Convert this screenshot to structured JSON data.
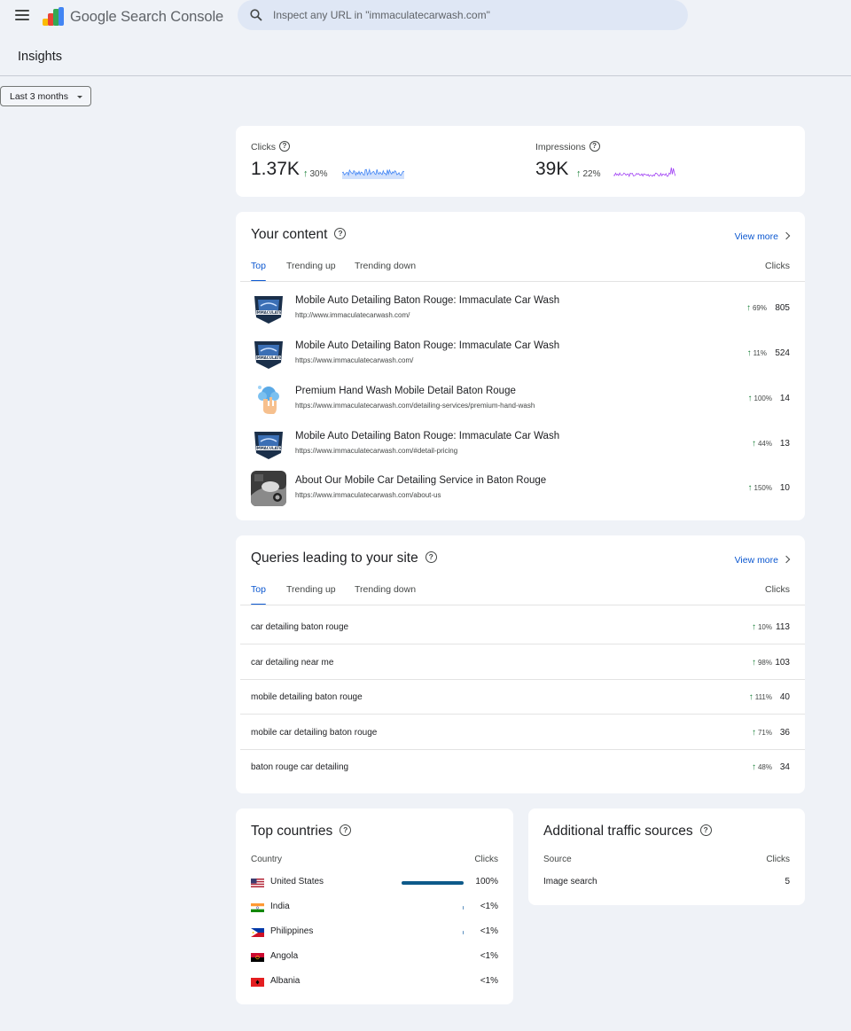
{
  "app": {
    "product_name": "Google Search Console",
    "search_placeholder": "Inspect any URL in \"immaculatecarwash.com\""
  },
  "page": {
    "title": "Insights",
    "date_filter": "Last 3 months"
  },
  "metrics": {
    "clicks": {
      "label": "Clicks",
      "value": "1.37K",
      "change": "30%",
      "spark_color": "#4285f4"
    },
    "impressions": {
      "label": "Impressions",
      "value": "39K",
      "change": "22%",
      "spark_color": "#a142f4"
    }
  },
  "content": {
    "title": "Your content",
    "view_more": "View more",
    "tabs": [
      "Top",
      "Trending up",
      "Trending down"
    ],
    "column": "Clicks",
    "rows": [
      {
        "title": "Mobile Auto Detailing Baton Rouge: Immaculate Car Wash",
        "url": "http://www.immaculatecarwash.com/",
        "change": "69%",
        "clicks": "805",
        "thumb": "logo-badge"
      },
      {
        "title": "Mobile Auto Detailing Baton Rouge: Immaculate Car Wash",
        "url": "https://www.immaculatecarwash.com/",
        "change": "11%",
        "clicks": "524",
        "thumb": "logo-badge"
      },
      {
        "title": "Premium Hand Wash Mobile Detail Baton Rouge",
        "url": "https://www.immaculatecarwash.com/detailing-services/premium-hand-wash",
        "change": "100%",
        "clicks": "14",
        "thumb": "hand-wash-icon"
      },
      {
        "title": "Mobile Auto Detailing Baton Rouge: Immaculate Car Wash",
        "url": "https://www.immaculatecarwash.com/#detail-pricing",
        "change": "44%",
        "clicks": "13",
        "thumb": "logo-badge"
      },
      {
        "title": "About Our Mobile Car Detailing Service in Baton Rouge",
        "url": "https://www.immaculatecarwash.com/about-us",
        "change": "150%",
        "clicks": "10",
        "thumb": "car-photo"
      }
    ]
  },
  "queries": {
    "title": "Queries leading to your site",
    "view_more": "View more",
    "tabs": [
      "Top",
      "Trending up",
      "Trending down"
    ],
    "column": "Clicks",
    "rows": [
      {
        "query": "car detailing baton rouge",
        "change": "10%",
        "clicks": "113"
      },
      {
        "query": "car detailing near me",
        "change": "98%",
        "clicks": "103"
      },
      {
        "query": "mobile detailing baton rouge",
        "change": "111%",
        "clicks": "40"
      },
      {
        "query": "mobile car detailing baton rouge",
        "change": "71%",
        "clicks": "36"
      },
      {
        "query": "baton rouge car detailing",
        "change": "48%",
        "clicks": "34"
      }
    ]
  },
  "countries": {
    "title": "Top countries",
    "col_country": "Country",
    "col_clicks": "Clicks",
    "rows": [
      {
        "name": "United States",
        "pct": "100%",
        "share": 1.0,
        "flag": "us-flag-icon"
      },
      {
        "name": "India",
        "pct": "<1%",
        "share": 0.005,
        "flag": "india-flag-icon"
      },
      {
        "name": "Philippines",
        "pct": "<1%",
        "share": 0.005,
        "flag": "philippines-flag-icon"
      },
      {
        "name": "Angola",
        "pct": "<1%",
        "share": 0,
        "flag": "angola-flag-icon"
      },
      {
        "name": "Albania",
        "pct": "<1%",
        "share": 0,
        "flag": "albania-flag-icon"
      }
    ]
  },
  "traffic": {
    "title": "Additional traffic sources",
    "col_source": "Source",
    "col_clicks": "Clicks",
    "rows": [
      {
        "source": "Image search",
        "clicks": "5"
      }
    ]
  }
}
